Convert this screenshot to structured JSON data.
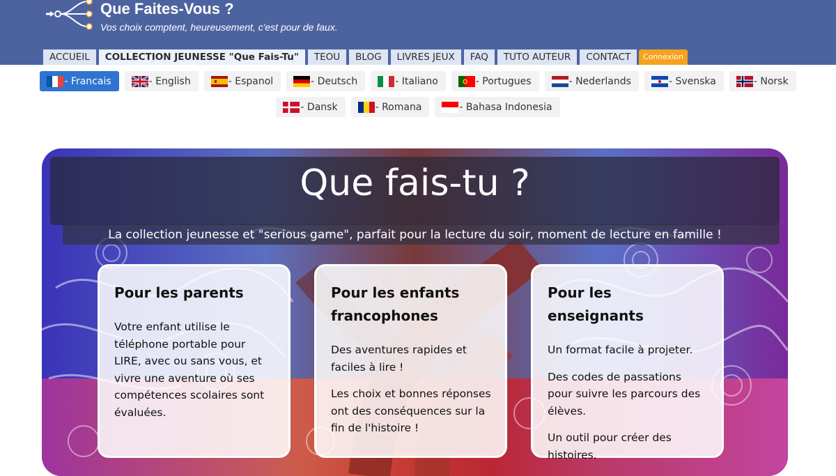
{
  "header": {
    "title": "Que Faites-Vous ?",
    "tagline": "Vos choix comptent, heureusement, c'est pour de faux.",
    "logo_icon": "network-nodes-icon"
  },
  "nav": {
    "tabs": [
      {
        "label": "ACCUEIL",
        "active": false
      },
      {
        "label": "COLLECTION JEUNESSE \"Que Fais-Tu\"",
        "active": true
      },
      {
        "label": "TEOU",
        "active": false
      },
      {
        "label": "BLOG",
        "active": false
      },
      {
        "label": "LIVRES JEUX",
        "active": false
      },
      {
        "label": "FAQ",
        "active": false
      },
      {
        "label": "TUTO AUTEUR",
        "active": false
      },
      {
        "label": "CONTACT",
        "active": false
      }
    ],
    "login_label": "Connexion"
  },
  "languages": {
    "row1": [
      {
        "label": "- Francais",
        "flag": "fr",
        "active": true
      },
      {
        "label": "- English",
        "flag": "gb",
        "active": false
      },
      {
        "label": "- Espanol",
        "flag": "es",
        "active": false
      },
      {
        "label": "- Deutsch",
        "flag": "de",
        "active": false
      },
      {
        "label": "- Italiano",
        "flag": "it",
        "active": false
      },
      {
        "label": "- Portugues",
        "flag": "pt",
        "active": false
      },
      {
        "label": "- Nederlands",
        "flag": "nl",
        "active": false
      },
      {
        "label": "- Svenska",
        "flag": "sv",
        "active": false
      },
      {
        "label": "- Norsk",
        "flag": "no",
        "active": false
      }
    ],
    "row2": [
      {
        "label": "- Dansk",
        "flag": "dk",
        "active": false
      },
      {
        "label": "- Romana",
        "flag": "ro",
        "active": false
      },
      {
        "label": "- Bahasa Indonesia",
        "flag": "id",
        "active": false
      }
    ]
  },
  "hero": {
    "title": "Que fais-tu ?",
    "subtitle": "La collection jeunesse et \"serious game\", parfait pour la lecture du soir, moment de lecture en famille !",
    "cards": [
      {
        "title": "Pour les parents",
        "paragraphs": [
          "Votre enfant utilise le téléphone portable pour LIRE, avec ou sans vous, et vivre une aventure où ses compétences scolaires sont évaluées."
        ]
      },
      {
        "title": "Pour les enfants francophones",
        "paragraphs": [
          "Des aventures rapides et faciles à lire !",
          "Les choix et bonnes réponses ont des conséquences sur la fin de l'histoire !"
        ]
      },
      {
        "title": "Pour les enseignants",
        "paragraphs": [
          "Un format facile à projeter.",
          "Des codes de passations pour suivre les parcours des élèves.",
          "Un outil pour créer des histoires."
        ]
      }
    ]
  }
}
